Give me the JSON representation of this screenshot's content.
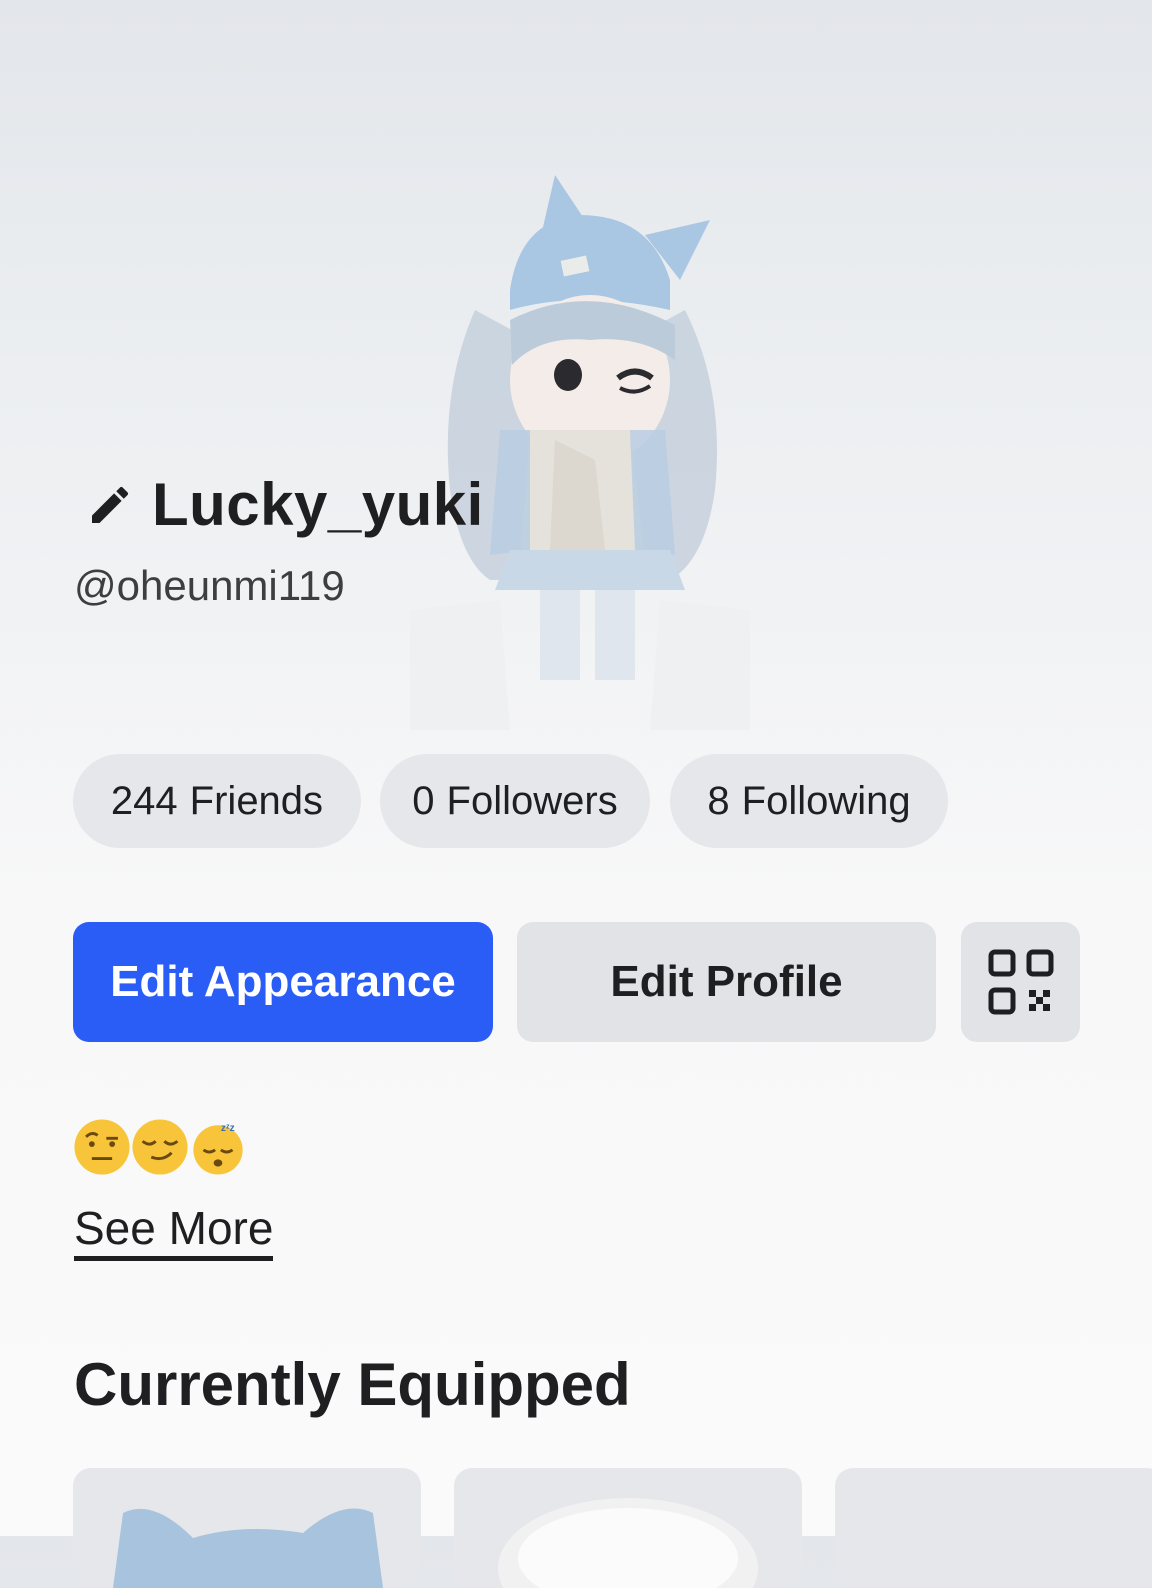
{
  "profile": {
    "display_name": "Lucky_yuki",
    "username": "@oheunmi119"
  },
  "stats": {
    "friends": {
      "count": "244",
      "label": "Friends"
    },
    "followers": {
      "count": "0",
      "label": "Followers"
    },
    "following": {
      "count": "8",
      "label": "Following"
    }
  },
  "actions": {
    "edit_appearance": "Edit Appearance",
    "edit_profile": "Edit Profile"
  },
  "about": {
    "emojis": [
      "face-with-raised-eyebrow",
      "smirking-face",
      "sleeping-face"
    ],
    "see_more": "See More"
  },
  "equipped": {
    "title": "Currently Equipped",
    "items": [
      "cat-ear-beanie",
      "white-hair-accessory",
      "item"
    ]
  },
  "icons": {
    "edit_name": "pencil-icon",
    "qr": "qr-code-icon"
  },
  "colors": {
    "primary": "#2a5df5",
    "pill_bg": "#e6e7ea",
    "button_secondary_bg": "#e2e3e7",
    "text": "#1f1f22"
  }
}
